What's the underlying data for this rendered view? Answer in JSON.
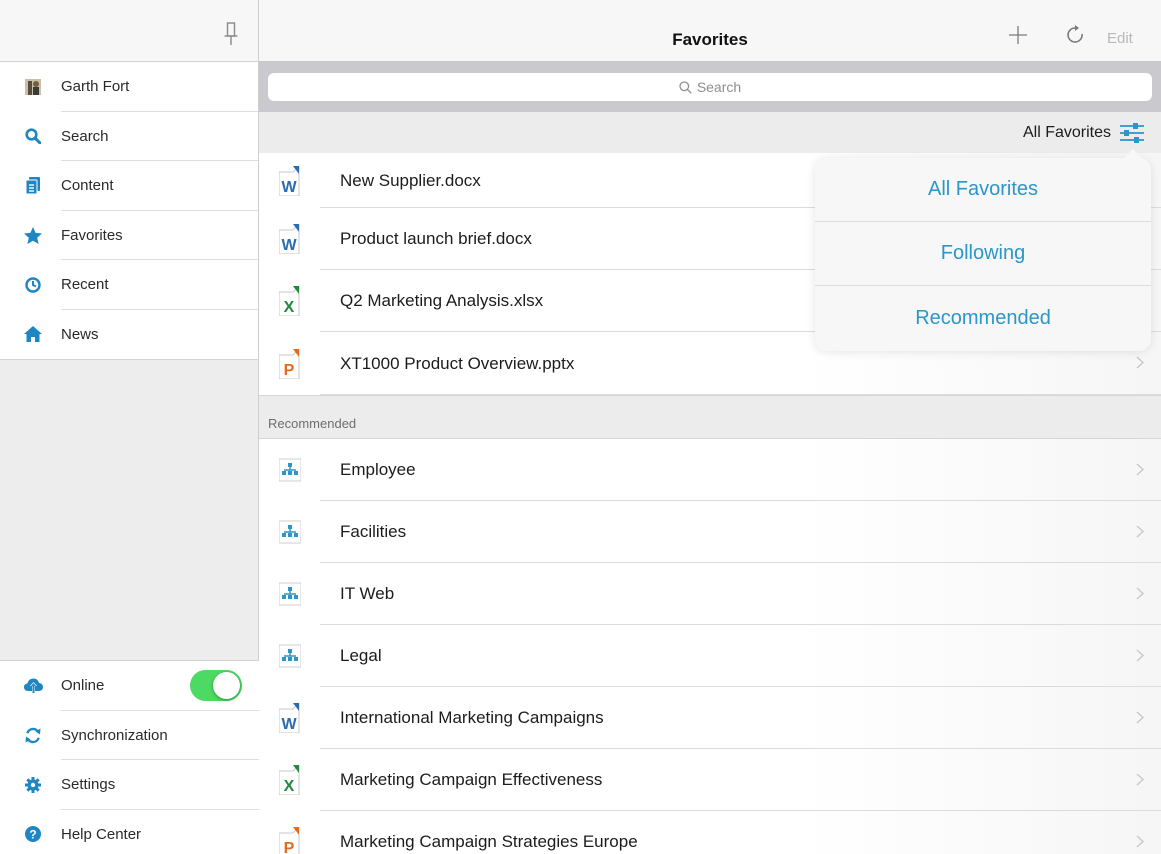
{
  "colors": {
    "accent": "#2b96c9",
    "word": "#2b6cb0",
    "excel": "#1e8a3c",
    "powerpoint": "#e36b1e",
    "toggle_on": "#4cd964"
  },
  "sidebar": {
    "items": [
      {
        "label": "Garth Fort",
        "icon": "avatar-icon"
      },
      {
        "label": "Search",
        "icon": "search-icon"
      },
      {
        "label": "Content",
        "icon": "content-icon"
      },
      {
        "label": "Favorites",
        "icon": "star-icon"
      },
      {
        "label": "Recent",
        "icon": "clock-icon"
      },
      {
        "label": "News",
        "icon": "home-icon"
      }
    ],
    "bottom": [
      {
        "label": "Online",
        "icon": "cloud-upload-icon",
        "toggle": true
      },
      {
        "label": "Synchronization",
        "icon": "sync-icon"
      },
      {
        "label": "Settings",
        "icon": "gear-icon"
      },
      {
        "label": "Help Center",
        "icon": "help-icon"
      }
    ]
  },
  "header": {
    "title": "Favorites",
    "edit_label": "Edit"
  },
  "search": {
    "placeholder": "Search"
  },
  "filter": {
    "current": "All Favorites",
    "options": [
      "All Favorites",
      "Following",
      "Recommended"
    ]
  },
  "favorites": [
    {
      "name": "New Supplier.docx",
      "type": "word"
    },
    {
      "name": "Product launch brief.docx",
      "type": "word"
    },
    {
      "name": "Q2 Marketing Analysis.xlsx",
      "type": "excel"
    },
    {
      "name": "XT1000 Product Overview.pptx",
      "type": "powerpoint"
    }
  ],
  "recommended": {
    "header": "Recommended",
    "items": [
      {
        "name": "Employee",
        "type": "site"
      },
      {
        "name": "Facilities",
        "type": "site"
      },
      {
        "name": "IT Web",
        "type": "site"
      },
      {
        "name": "Legal",
        "type": "site"
      },
      {
        "name": "International Marketing Campaigns",
        "type": "word"
      },
      {
        "name": "Marketing Campaign Effectiveness",
        "type": "excel"
      },
      {
        "name": "Marketing Campaign Strategies Europe",
        "type": "powerpoint"
      }
    ]
  }
}
